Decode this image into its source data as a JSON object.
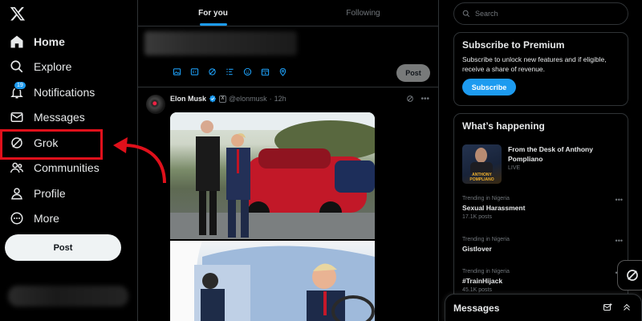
{
  "nav": {
    "items": [
      {
        "label": "Home",
        "icon": "home-icon"
      },
      {
        "label": "Explore",
        "icon": "search-icon"
      },
      {
        "label": "Notifications",
        "icon": "bell-icon",
        "badge": "19"
      },
      {
        "label": "Messages",
        "icon": "mail-icon"
      },
      {
        "label": "Grok",
        "icon": "grok-icon"
      },
      {
        "label": "Communities",
        "icon": "people-icon"
      },
      {
        "label": "Profile",
        "icon": "person-icon"
      },
      {
        "label": "More",
        "icon": "more-circle-icon"
      }
    ],
    "post_label": "Post"
  },
  "tabs": [
    {
      "label": "For you"
    },
    {
      "label": "Following"
    }
  ],
  "composer": {
    "post_label": "Post"
  },
  "tweet": {
    "name": "Elon Musk",
    "badge_letter": "X",
    "handle": "@elonmusk",
    "sep": "·",
    "time": "12h"
  },
  "search": {
    "placeholder": "Search"
  },
  "premium": {
    "title": "Subscribe to Premium",
    "text": "Subscribe to unlock new features and if eligible, receive a share of revenue.",
    "button": "Subscribe"
  },
  "happening": {
    "title": "What’s happening",
    "featured": {
      "title": "From the Desk of Anthony Pompliano",
      "status": "LIVE",
      "image_text": "ANTHONY POMPLIANO"
    },
    "trends": [
      {
        "context": "Trending in Nigeria",
        "title": "Sexual Harassment",
        "count": "17.1K posts"
      },
      {
        "context": "Trending in Nigeria",
        "title": "Gistlover",
        "count": ""
      },
      {
        "context": "Trending in Nigeria",
        "title": "#TrainHijack",
        "count": "45.1K posts"
      }
    ]
  },
  "messages_dock": {
    "title": "Messages"
  },
  "colors": {
    "accent": "#1d9bf0",
    "highlight": "#e0101b",
    "background": "#000000"
  }
}
